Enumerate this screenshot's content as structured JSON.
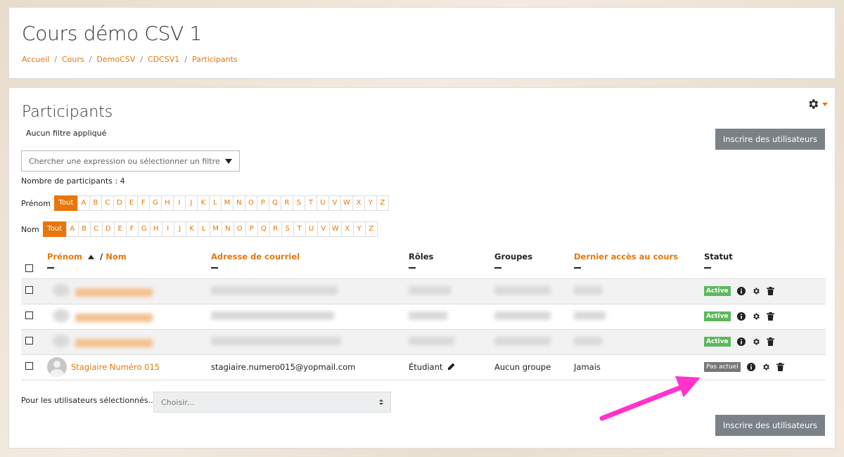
{
  "header": {
    "title": "Cours démo CSV 1",
    "breadcrumb": [
      "Accueil",
      "Cours",
      "DemoCSV",
      "CDCSV1",
      "Participants"
    ]
  },
  "participants": {
    "title": "Participants",
    "filter_status": "Aucun filtre appliqué",
    "enrol_button": "Inscrire des utilisateurs",
    "filter_placeholder": "Chercher une expression ou sélectionner un filtre",
    "count": "Nombre de participants : 4",
    "firstname_label": "Prénom",
    "lastname_label": "Nom",
    "all_label": "Tout",
    "letters": [
      "A",
      "B",
      "C",
      "D",
      "E",
      "F",
      "G",
      "H",
      "I",
      "J",
      "K",
      "L",
      "M",
      "N",
      "O",
      "P",
      "Q",
      "R",
      "S",
      "T",
      "U",
      "V",
      "W",
      "X",
      "Y",
      "Z"
    ]
  },
  "table": {
    "headers": {
      "firstname": "Prénom",
      "slash": " / ",
      "lastname": "Nom",
      "email": "Adresse de courriel",
      "roles": "Rôles",
      "groups": "Groupes",
      "last_access": "Dernier accès au cours",
      "status": "Statut"
    },
    "rows": [
      {
        "status": "Active"
      },
      {
        "status": "Active"
      },
      {
        "status": "Active"
      },
      {
        "name": "Stagiaire Numéro 015",
        "email": "stagiaire.numero015@yopmail.com",
        "role": "Étudiant",
        "group": "Aucun groupe",
        "last_access": "Jamais",
        "status": "Pas actuel"
      }
    ]
  },
  "bulk": {
    "label": "Pour les utilisateurs sélectionnés...",
    "select_value": "Choisir..."
  },
  "colors": {
    "accent": "#e8760a",
    "active": "#5cb85c",
    "inactive": "#777777",
    "button": "#7a8288",
    "callout": "#ff33cc"
  },
  "icons": [
    "gear-icon",
    "info-icon",
    "cog-icon",
    "trash-icon",
    "pencil-icon",
    "sort-asc-icon",
    "dropdown-caret-icon",
    "avatar-placeholder-icon"
  ]
}
